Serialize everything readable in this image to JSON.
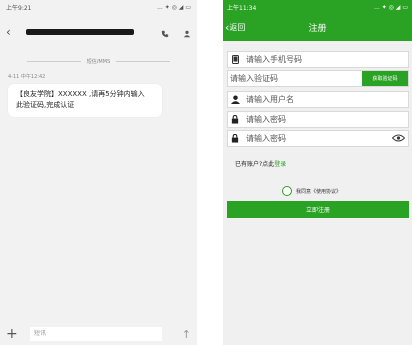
{
  "left": {
    "status": {
      "time": "上午9:21",
      "icons": "... ✦ ◎ ◢ ▭"
    },
    "separator": "短信/MMS",
    "msg_time": "4-11 中午12:42",
    "message_line1": "【良友学院】XXXXXX ,请再5分钟内输入",
    "message_line2": "此验证码,完成认证",
    "input_placeholder": "短讯"
  },
  "right": {
    "status": {
      "time": "上午11:34",
      "icons": "... ✦ ◎ ◢ ▭"
    },
    "back_label": "返回",
    "title": "注册",
    "phone_placeholder": "请输入手机号码",
    "code_placeholder": "请输入验证码",
    "code_button": "获取验证码",
    "username_placeholder": "请输入用户名",
    "password_placeholder": "请输入密码",
    "password_confirm_placeholder": "请输入密码",
    "login_prompt": "已有账户?点此",
    "login_link": "登录",
    "agree_text": "我同意《使用协议》",
    "register_button": "立即注册"
  },
  "colors": {
    "accent": "#2aa224"
  }
}
